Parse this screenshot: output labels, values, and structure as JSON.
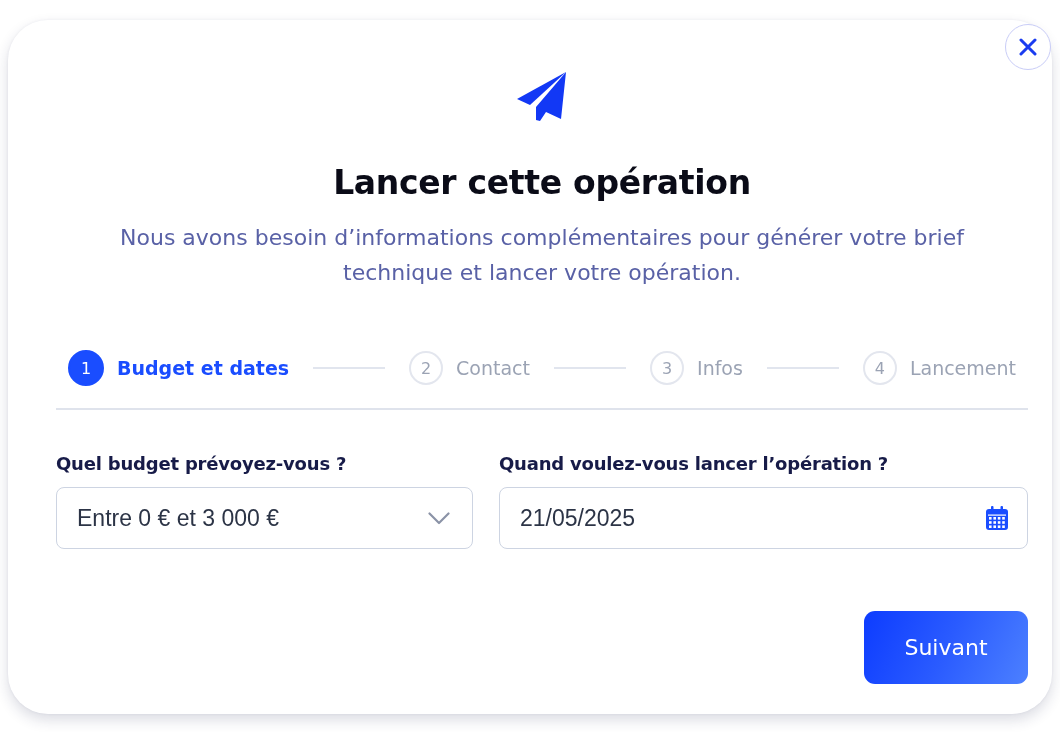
{
  "dialog": {
    "title": "Lancer cette opération",
    "subtitle": "Nous avons besoin d’informations complémentaires pour générer votre brief technique et lancer votre opération."
  },
  "steps": [
    {
      "number": "1",
      "label": "Budget et dates",
      "selected": true
    },
    {
      "number": "2",
      "label": "Contact",
      "selected": false
    },
    {
      "number": "3",
      "label": "Infos",
      "selected": false
    },
    {
      "number": "4",
      "label": "Lancement",
      "selected": false
    }
  ],
  "fields": [
    {
      "kind": "select",
      "label": "Quel budget prévoyez-vous ?",
      "value": "Entre 0 € et 3 000 €"
    },
    {
      "kind": "date",
      "label": "Quand voulez-vous lancer l’opération ?",
      "value": "21/05/2025"
    }
  ],
  "buttons": [
    {
      "label": "Suivant"
    }
  ]
}
